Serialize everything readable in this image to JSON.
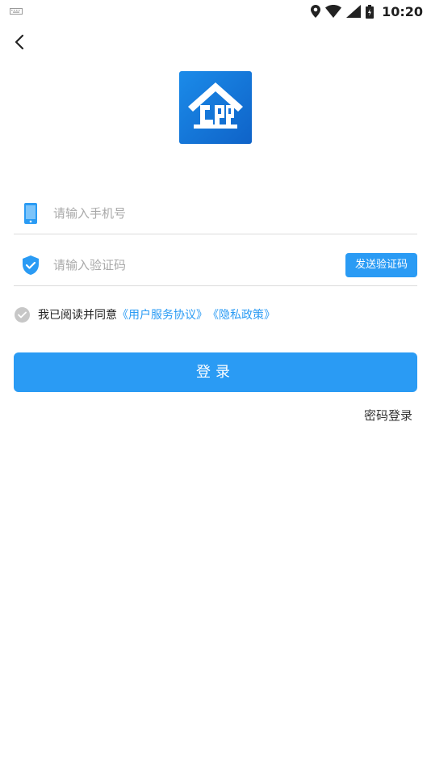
{
  "status_bar": {
    "time": "10:20",
    "icons": [
      "keyboard-icon",
      "location-icon",
      "wifi-icon",
      "cellular-signal-icon",
      "battery-icon"
    ]
  },
  "nav": {
    "back_icon": "chevron-left-icon"
  },
  "logo": {
    "icon": "house-logo-icon",
    "bg_colors": [
      "#1b8be9",
      "#0f63c8"
    ]
  },
  "form": {
    "phone": {
      "icon": "mobile-phone-icon",
      "placeholder": "请输入手机号",
      "value": ""
    },
    "code": {
      "icon": "shield-check-icon",
      "placeholder": "请输入验证码",
      "value": "",
      "send_label": "发送验证码"
    }
  },
  "agreement": {
    "prefix": "我已阅读并同意",
    "terms_link": "《用户服务协议》",
    "privacy_link": "《隐私政策》",
    "checked": false
  },
  "actions": {
    "login_label": "登录",
    "password_login_label": "密码登录"
  },
  "colors": {
    "accent": "#2a9bf4",
    "divider": "#dcdcdc",
    "checkbox_off": "#c7c7c7"
  }
}
